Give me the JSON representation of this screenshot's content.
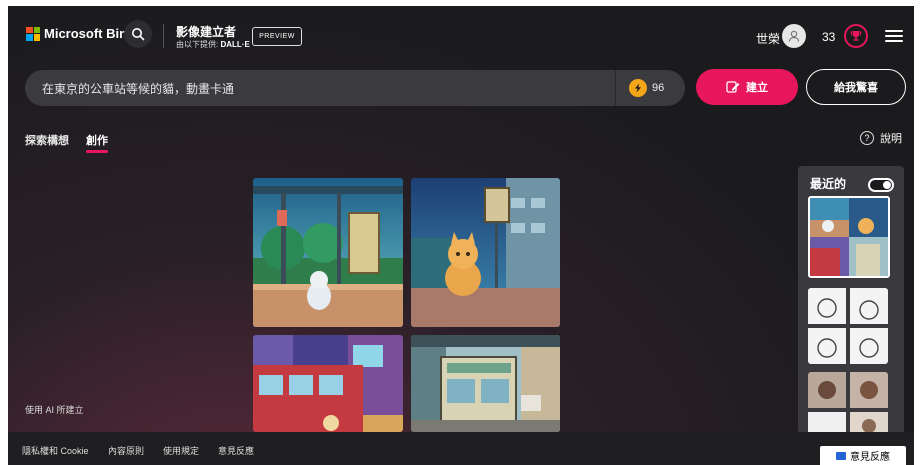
{
  "header": {
    "brand": "Microsoft Bing",
    "brand_colors": [
      "#f25022",
      "#7fba00",
      "#00a4ef",
      "#ffb900"
    ],
    "product_title": "影像建立者",
    "powered_by_prefix": "由以下提供:",
    "powered_by_name": "DALL·E",
    "preview_label": "PREVIEW",
    "user_name": "世榮",
    "reward_points": "33",
    "icons": [
      "search-icon",
      "user-icon",
      "trophy-icon",
      "menu-icon"
    ]
  },
  "prompt": {
    "value": "在東京的公車站等候的貓，動畫卡通",
    "boosts": "96",
    "create_label": "建立",
    "surprise_label": "給我驚喜"
  },
  "tabs": [
    {
      "label": "探索構想",
      "active": false
    },
    {
      "label": "創作",
      "active": true
    }
  ],
  "help_label": "說明",
  "recent": {
    "label": "最近的",
    "toggle_on": true
  },
  "ai_note": "使用 AI 所建立",
  "footer": {
    "links": [
      "隱私權和 Cookie",
      "內容原則",
      "使用規定",
      "意見反應"
    ],
    "feedback_button": "意見反應"
  },
  "colors": {
    "accent": "#e8175d",
    "boost": "#f2a618",
    "background": "#1b1b1e"
  }
}
